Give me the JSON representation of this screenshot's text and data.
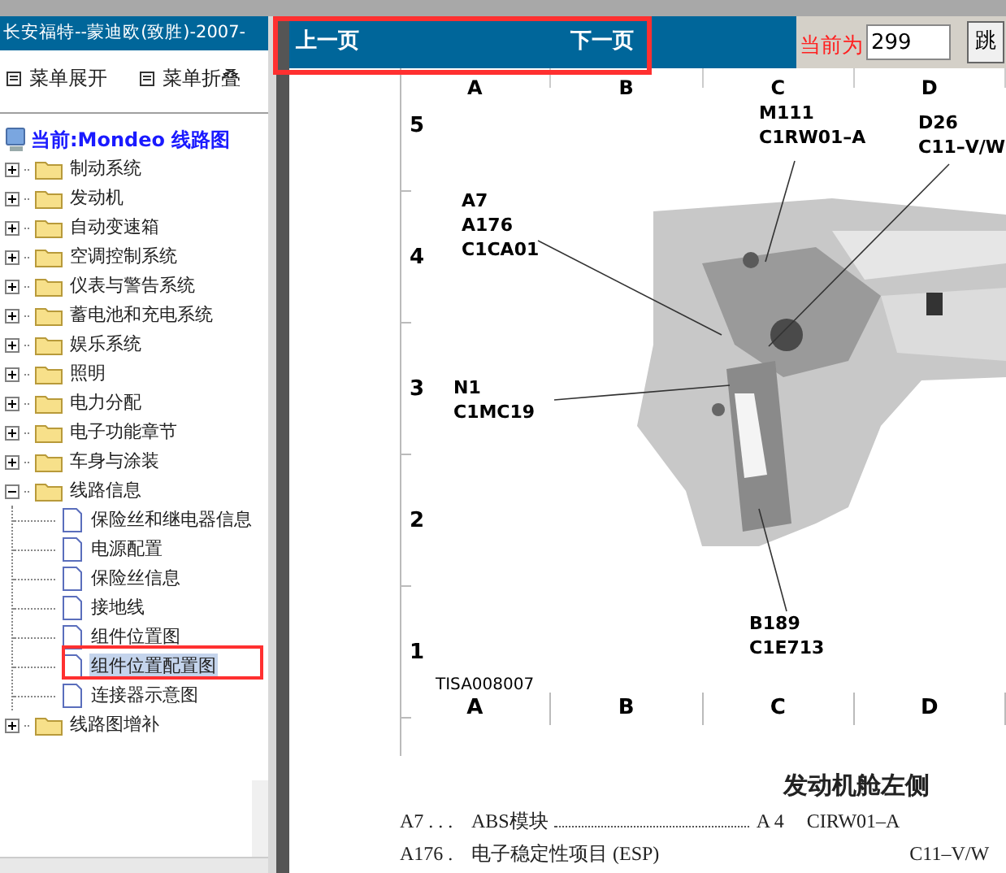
{
  "sidebar": {
    "title": "长安福特--蒙迪欧(致胜)-2007-",
    "menu_buttons": [
      "菜单展开",
      "菜单折叠"
    ],
    "tree_root": "当前:Mondeo 线路图",
    "tree": [
      {
        "label": "制动系统",
        "expanded": false
      },
      {
        "label": "发动机",
        "expanded": false
      },
      {
        "label": "自动变速箱",
        "expanded": false
      },
      {
        "label": "空调控制系统",
        "expanded": false
      },
      {
        "label": "仪表与警告系统",
        "expanded": false
      },
      {
        "label": "蓄电池和充电系统",
        "expanded": false
      },
      {
        "label": "娱乐系统",
        "expanded": false
      },
      {
        "label": "照明",
        "expanded": false
      },
      {
        "label": "电力分配",
        "expanded": false
      },
      {
        "label": "电子功能章节",
        "expanded": false
      },
      {
        "label": "车身与涂装",
        "expanded": false
      },
      {
        "label": "线路信息",
        "expanded": true,
        "children": [
          {
            "label": "保险丝和继电器信息",
            "selected": false
          },
          {
            "label": "电源配置",
            "selected": false
          },
          {
            "label": "保险丝信息",
            "selected": false
          },
          {
            "label": "接地线",
            "selected": false
          },
          {
            "label": "组件位置图",
            "selected": false
          },
          {
            "label": "组件位置配置图",
            "selected": true
          },
          {
            "label": "连接器示意图",
            "selected": false
          }
        ]
      },
      {
        "label": "线路图增补",
        "expanded": false
      }
    ]
  },
  "nav": {
    "prev": "上一页",
    "next": "下一页",
    "page_label": "当前为",
    "page_value": "299",
    "jump_button": "跳"
  },
  "diagram": {
    "columns_top": [
      "A",
      "B",
      "C",
      "D"
    ],
    "rows": [
      "5",
      "4",
      "3",
      "2",
      "1"
    ],
    "callouts": [
      {
        "lines": [
          "M111",
          "C1RW01–A"
        ]
      },
      {
        "lines": [
          "D26",
          "C11–V/W"
        ]
      },
      {
        "lines": [
          "A7",
          "A176",
          "C1CA01"
        ]
      },
      {
        "lines": [
          "N1",
          "C1MC19"
        ]
      },
      {
        "lines": [
          "B189",
          "C1E713"
        ]
      }
    ],
    "figure_id": "TISA008007",
    "columns_bottom": [
      "A",
      "B",
      "C",
      "D"
    ]
  },
  "legend": {
    "title": "发动机舱左侧",
    "rows": [
      {
        "code": "A7 . . .",
        "description": "ABS模块",
        "ref": "A 4",
        "next": "CIRW01–A"
      },
      {
        "code": "A176 .",
        "description": "电子稳定性项目 (ESP)",
        "next": "C11–V/W"
      }
    ]
  }
}
